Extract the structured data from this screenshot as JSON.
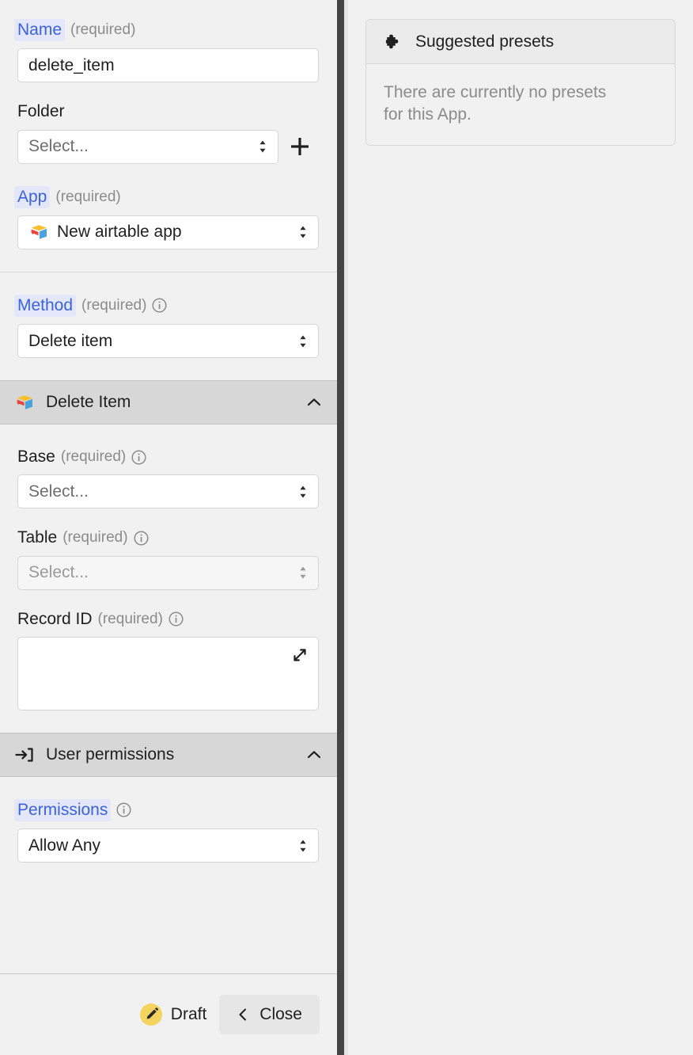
{
  "form": {
    "name": {
      "label": "Name",
      "required_text": "(required)",
      "value": "delete_item"
    },
    "folder": {
      "label": "Folder",
      "placeholder": "Select...",
      "add_icon": "plus-icon"
    },
    "app": {
      "label": "App",
      "required_text": "(required)",
      "value": "New airtable app",
      "icon": "airtable-icon"
    },
    "method": {
      "label": "Method",
      "required_text": "(required)",
      "value": "Delete item",
      "info_icon": "info-icon"
    }
  },
  "delete_item_section": {
    "title": "Delete Item",
    "icon": "airtable-icon",
    "collapse_icon": "chevron-up-icon",
    "base": {
      "label": "Base",
      "required_text": "(required)",
      "placeholder": "Select...",
      "info_icon": "info-icon"
    },
    "table": {
      "label": "Table",
      "required_text": "(required)",
      "placeholder": "Select...",
      "info_icon": "info-icon",
      "disabled": true
    },
    "record_id": {
      "label": "Record ID",
      "required_text": "(required)",
      "value": "",
      "info_icon": "info-icon",
      "expand_icon": "expand-diagonal-icon"
    }
  },
  "user_permissions_section": {
    "title": "User permissions",
    "icon": "login-arrow-icon",
    "collapse_icon": "chevron-up-icon",
    "permissions": {
      "label": "Permissions",
      "value": "Allow Any",
      "info_icon": "info-icon"
    }
  },
  "footer": {
    "draft_label": "Draft",
    "draft_icon": "pencil-icon",
    "close_label": "Close",
    "close_icon": "chevron-left-icon"
  },
  "presets_panel": {
    "title": "Suggested presets",
    "icon": "puzzle-piece-icon",
    "empty_message": "There are currently no presets for this App."
  },
  "colors": {
    "accent_blue": "#3b63db",
    "accent_blue_bg": "#e4e7f9",
    "panel_bg": "#f1f1f1",
    "section_header_bg": "#d7d7d7",
    "draft_yellow": "#f4d35e",
    "divider_dark": "#444444"
  }
}
